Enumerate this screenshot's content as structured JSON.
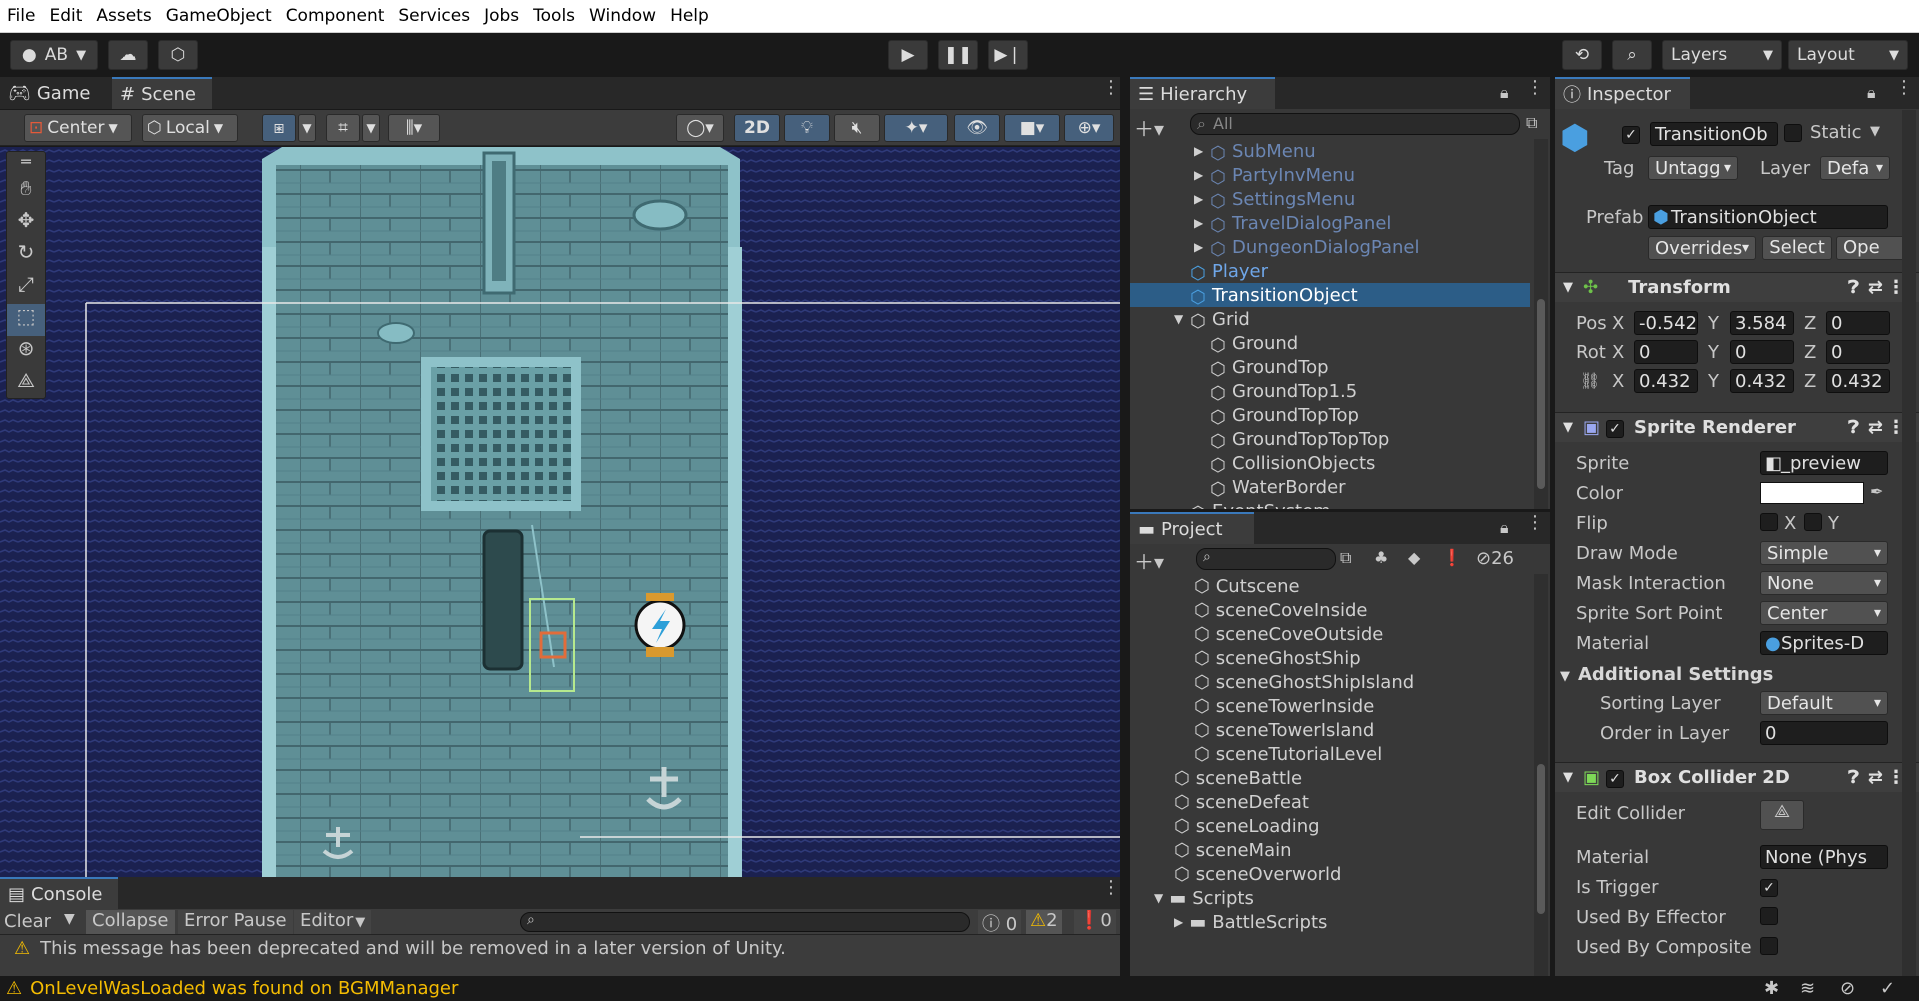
{
  "menu": [
    "File",
    "Edit",
    "Assets",
    "GameObject",
    "Component",
    "Services",
    "Jobs",
    "Tools",
    "Window",
    "Help"
  ],
  "toolbar": {
    "account": "AB",
    "layers": "Layers",
    "layout": "Layout"
  },
  "tabs": {
    "game": "Game",
    "scene": "Scene",
    "hierarchy": "Hierarchy",
    "inspector": "Inspector",
    "project": "Project",
    "console": "Console"
  },
  "scene_tools": {
    "pivot": "Center",
    "space": "Local",
    "mode2d": "2D"
  },
  "hierarchy": {
    "search_placeholder": "All",
    "items": [
      {
        "label": "SubMenu",
        "indent": 3,
        "muted": true,
        "arrow": true
      },
      {
        "label": "PartyInvMenu",
        "indent": 3,
        "muted": true,
        "arrow": true
      },
      {
        "label": "SettingsMenu",
        "indent": 3,
        "muted": true,
        "arrow": true
      },
      {
        "label": "TravelDialogPanel",
        "indent": 3,
        "muted": true,
        "arrow": true
      },
      {
        "label": "DungeonDialogPanel",
        "indent": 3,
        "muted": true,
        "arrow": true
      },
      {
        "label": "Player",
        "indent": 2,
        "prefab": true
      },
      {
        "label": "TransitionObject",
        "indent": 2,
        "prefab": true,
        "selected": true
      },
      {
        "label": "Grid",
        "indent": 2,
        "expanded": true
      },
      {
        "label": "Ground",
        "indent": 3
      },
      {
        "label": "GroundTop",
        "indent": 3
      },
      {
        "label": "GroundTop1.5",
        "indent": 3
      },
      {
        "label": "GroundTopTop",
        "indent": 3
      },
      {
        "label": "GroundTopTopTop",
        "indent": 3
      },
      {
        "label": "CollisionObjects",
        "indent": 3
      },
      {
        "label": "WaterBorder",
        "indent": 3
      },
      {
        "label": "EventSystem",
        "indent": 2
      }
    ]
  },
  "project": {
    "hidden_count": "26",
    "items": [
      {
        "label": "Cutscene",
        "indent": 2
      },
      {
        "label": "sceneCoveInside",
        "indent": 2
      },
      {
        "label": "sceneCoveOutside",
        "indent": 2
      },
      {
        "label": "sceneGhostShip",
        "indent": 2
      },
      {
        "label": "sceneGhostShipIsland",
        "indent": 2
      },
      {
        "label": "sceneTowerInside",
        "indent": 2
      },
      {
        "label": "sceneTowerIsland",
        "indent": 2
      },
      {
        "label": "sceneTutorialLevel",
        "indent": 2
      },
      {
        "label": "sceneBattle",
        "indent": 1
      },
      {
        "label": "sceneDefeat",
        "indent": 1
      },
      {
        "label": "sceneLoading",
        "indent": 1
      },
      {
        "label": "sceneMain",
        "indent": 1
      },
      {
        "label": "sceneOverworld",
        "indent": 1
      },
      {
        "label": "Scripts",
        "indent": 0,
        "folder": true,
        "expanded": true
      },
      {
        "label": "BattleScripts",
        "indent": 1,
        "folder": true
      }
    ]
  },
  "inspector": {
    "name": "TransitionOb",
    "static_label": "Static",
    "tag_label": "Tag",
    "tag_value": "Untagg",
    "layer_label": "Layer",
    "layer_value": "Defa",
    "prefab_label": "Prefab",
    "prefab_value": "TransitionObject",
    "overrides": "Overrides",
    "select": "Select",
    "open": "Ope",
    "transform": {
      "title": "Transform",
      "pos_label": "Pos",
      "rot_label": "Rot",
      "pos": {
        "x": "-0.542",
        "y": "3.584",
        "z": "0"
      },
      "rot": {
        "x": "0",
        "y": "0",
        "z": "0"
      },
      "scale": {
        "x": "0.432",
        "y": "0.432",
        "z": "0.432"
      }
    },
    "sprite_renderer": {
      "title": "Sprite Renderer",
      "sprite_label": "Sprite",
      "sprite_value": "_preview",
      "color_label": "Color",
      "flip_label": "Flip",
      "flip_x": "X",
      "flip_y": "Y",
      "draw_mode_label": "Draw Mode",
      "draw_mode": "Simple",
      "mask_label": "Mask Interaction",
      "mask": "None",
      "sort_point_label": "Sprite Sort Point",
      "sort_point": "Center",
      "material_label": "Material",
      "material": "Sprites-D",
      "additional": "Additional Settings",
      "sorting_layer_label": "Sorting Layer",
      "sorting_layer": "Default",
      "order_label": "Order in Layer",
      "order": "0"
    },
    "box_collider": {
      "title": "Box Collider 2D",
      "edit_label": "Edit Collider",
      "material_label": "Material",
      "material": "None (Phys",
      "trigger_label": "Is Trigger",
      "effector_label": "Used By Effector",
      "composite_label": "Used By Composite"
    }
  },
  "console": {
    "clear": "Clear",
    "collapse": "Collapse",
    "error_pause": "Error Pause",
    "editor": "Editor",
    "count_info": "0",
    "count_warn": "2",
    "count_error": "0",
    "message": "This message has been deprecated and will be removed in a later version of Unity."
  },
  "status": {
    "message": "OnLevelWasLoaded was found on BGMManager"
  },
  "colors": {
    "accent": "#2c5d87",
    "warning": "#f4bc02",
    "prefab": "#4a8cd8",
    "water": "#1b2150",
    "deck": "#5f8f96"
  }
}
